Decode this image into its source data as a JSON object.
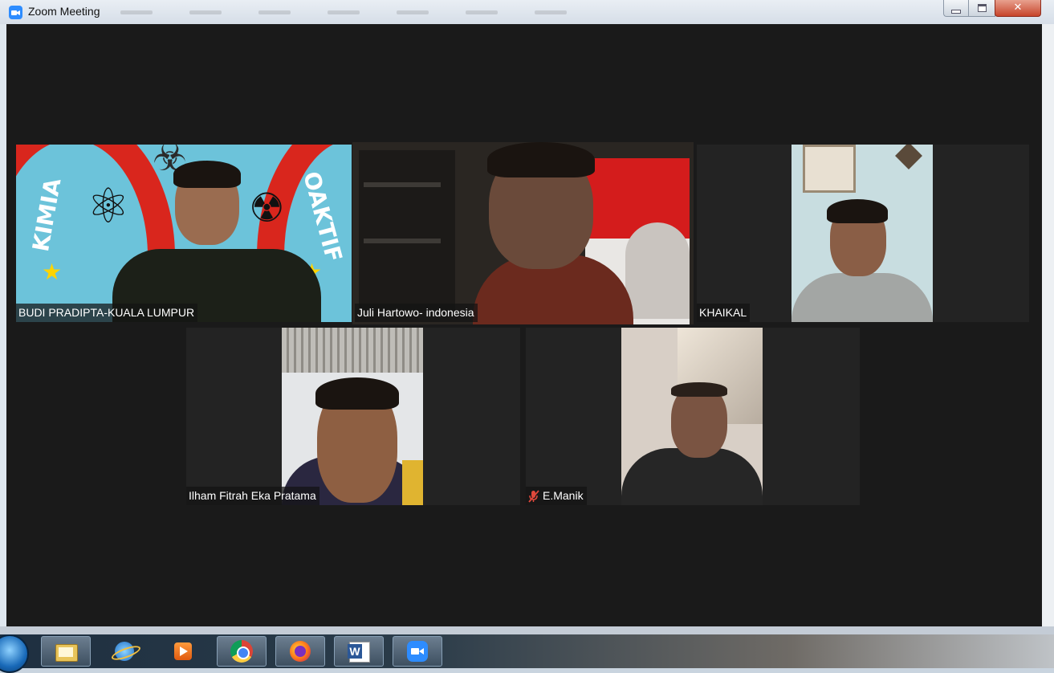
{
  "window": {
    "title": "Zoom Meeting",
    "controls": [
      "minimize",
      "maximize",
      "close"
    ]
  },
  "participants": [
    {
      "name": "BUDI PRADIPTA-KUALA LUMPUR",
      "muted": false,
      "active_speaker": false
    },
    {
      "name": "Juli Hartowo- indonesia",
      "muted": false,
      "active_speaker": true
    },
    {
      "name": "KHAIKAL",
      "muted": false,
      "active_speaker": false
    },
    {
      "name": "Ilham Fitrah Eka Pratama",
      "muted": false,
      "active_speaker": false
    },
    {
      "name": "E.Manik",
      "muted": true,
      "active_speaker": false
    }
  ],
  "poster": {
    "word_left": "KIMIA",
    "word_right": "OAKTIF"
  },
  "taskbar": {
    "items": [
      "start-orb",
      "file-explorer",
      "internet-explorer",
      "media-player",
      "chrome",
      "firefox",
      "word",
      "zoom"
    ]
  },
  "colors": {
    "stage_bg": "#1a1a1a",
    "active_speaker_border": "#d7e37a",
    "muted_icon": "#e0483b",
    "zoom_blue": "#2d8cff"
  }
}
